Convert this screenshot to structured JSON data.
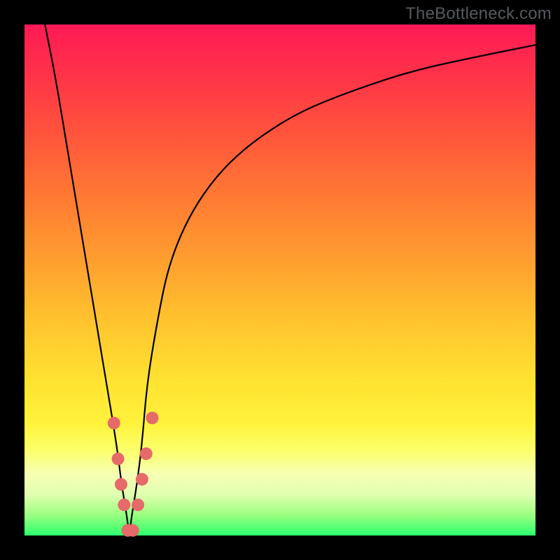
{
  "watermark_text": "TheBottleneck.com",
  "chart_data": {
    "type": "line",
    "title": "",
    "xlabel": "",
    "ylabel": "",
    "ylim": [
      0,
      100
    ],
    "xlim": [
      0,
      100
    ],
    "series": [
      {
        "name": "bottleneck-curve",
        "x": [
          4,
          6,
          8,
          10,
          12,
          14,
          16,
          18,
          19,
          20,
          20.5,
          21,
          22,
          23,
          24,
          26,
          28,
          31,
          35,
          40,
          46,
          54,
          64,
          76,
          90,
          100
        ],
        "values": [
          100,
          90,
          78,
          66,
          54,
          42,
          30,
          18,
          10,
          4,
          0,
          4,
          10,
          18,
          30,
          42,
          52,
          60,
          67,
          73,
          78,
          83,
          87,
          91,
          94,
          96
        ]
      }
    ],
    "markers": [
      {
        "name": "dot-left-1",
        "x": 17.5,
        "values": 22
      },
      {
        "name": "dot-left-2",
        "x": 18.3,
        "values": 15
      },
      {
        "name": "dot-left-3",
        "x": 18.9,
        "values": 10
      },
      {
        "name": "dot-left-4",
        "x": 19.5,
        "values": 6
      },
      {
        "name": "dot-bottom-1",
        "x": 20.2,
        "values": 1
      },
      {
        "name": "dot-bottom-2",
        "x": 21.2,
        "values": 1
      },
      {
        "name": "dot-right-1",
        "x": 22.2,
        "values": 6
      },
      {
        "name": "dot-right-2",
        "x": 23.0,
        "values": 11
      },
      {
        "name": "dot-right-3",
        "x": 23.8,
        "values": 16
      },
      {
        "name": "dot-right-4",
        "x": 25.0,
        "values": 23
      }
    ],
    "marker_color": "#e66a6a",
    "curve_color": "#000000"
  }
}
